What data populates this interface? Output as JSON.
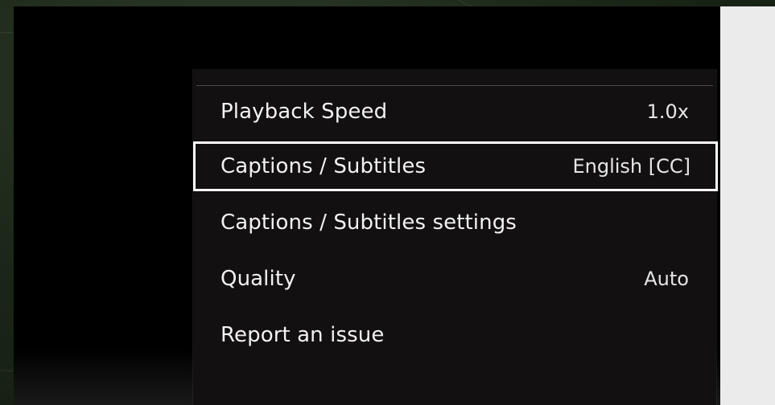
{
  "menu": {
    "items": [
      {
        "label": "Playback Speed",
        "value": "1.0x",
        "focused": false
      },
      {
        "label": "Captions / Subtitles",
        "value": "English [CC]",
        "focused": true
      },
      {
        "label": "Captions / Subtitles settings",
        "value": "",
        "focused": false
      },
      {
        "label": "Quality",
        "value": "Auto",
        "focused": false
      },
      {
        "label": "Report an issue",
        "value": "",
        "focused": false
      }
    ]
  },
  "colors": {
    "menu_background": "#121010",
    "focus_outline": "#ffffff",
    "text": "#f2f2f2",
    "player_background": "#000000",
    "side_panel": "#ebebeb"
  }
}
